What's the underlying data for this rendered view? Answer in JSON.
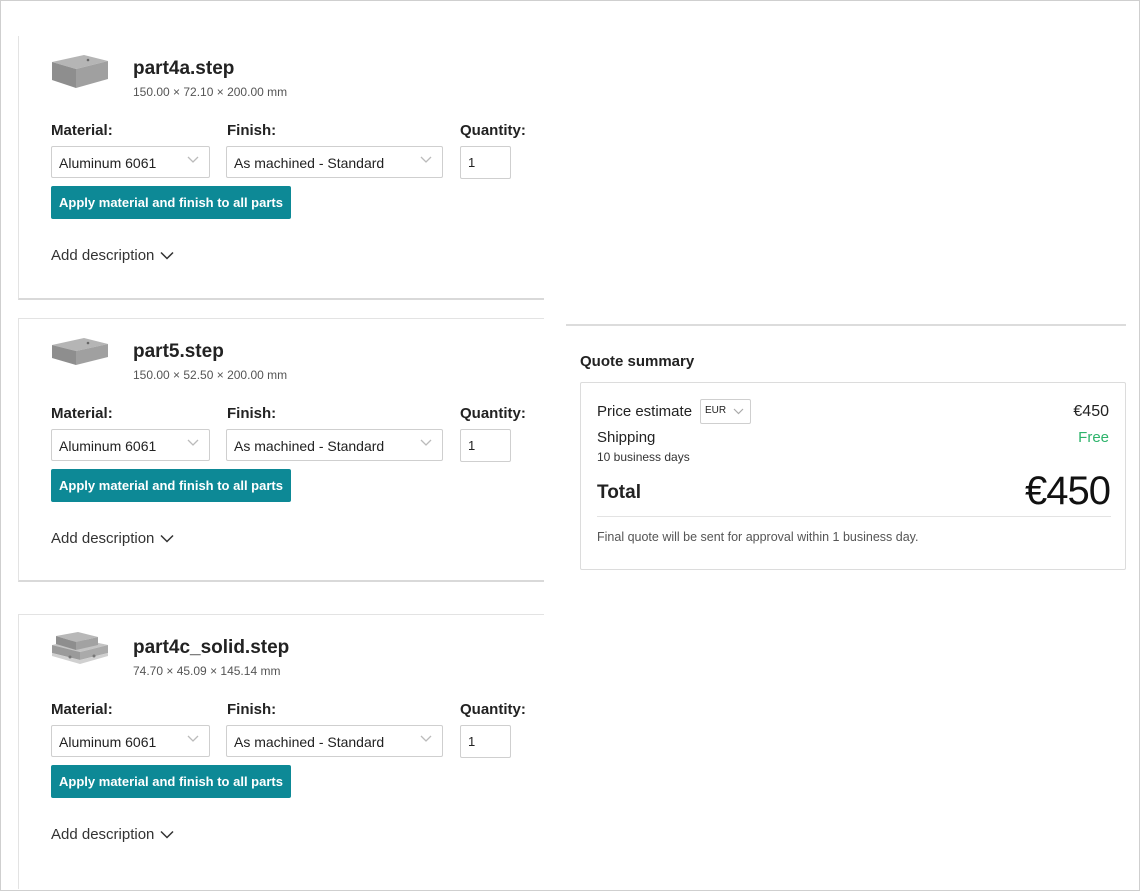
{
  "parts": [
    {
      "name": "part4a.step",
      "dimensions": "150.00 × 72.10 × 200.00 mm",
      "material_label": "Material:",
      "material_value": "Aluminum 6061",
      "finish_label": "Finish:",
      "finish_value": "As machined - Standard",
      "quantity_label": "Quantity:",
      "quantity_value": "1",
      "apply_label": "Apply material and finish to all parts",
      "add_description_label": "Add description",
      "thumbnail_icon": "box-part-icon"
    },
    {
      "name": "part5.step",
      "dimensions": "150.00 × 52.50 × 200.00 mm",
      "material_label": "Material:",
      "material_value": "Aluminum 6061",
      "finish_label": "Finish:",
      "finish_value": "As machined - Standard",
      "quantity_label": "Quantity:",
      "quantity_value": "1",
      "apply_label": "Apply material and finish to all parts",
      "add_description_label": "Add description",
      "thumbnail_icon": "box-part-icon"
    },
    {
      "name": "part4c_solid.step",
      "dimensions": "74.70 × 45.09 × 145.14 mm",
      "material_label": "Material:",
      "material_value": "Aluminum 6061",
      "finish_label": "Finish:",
      "finish_value": "As machined - Standard",
      "quantity_label": "Quantity:",
      "quantity_value": "1",
      "apply_label": "Apply material and finish to all parts",
      "add_description_label": "Add description",
      "thumbnail_icon": "stepped-part-icon"
    }
  ],
  "summary": {
    "title": "Quote summary",
    "price_label": "Price estimate",
    "currency": "EUR",
    "price_value": "€450",
    "shipping_label": "Shipping",
    "shipping_value": "Free",
    "shipping_days": "10 business days",
    "total_label": "Total",
    "total_value": "€450",
    "note": "Final quote will be sent for approval within 1 business day."
  },
  "colors": {
    "accent": "#0d8996",
    "free_green": "#2db36b"
  }
}
